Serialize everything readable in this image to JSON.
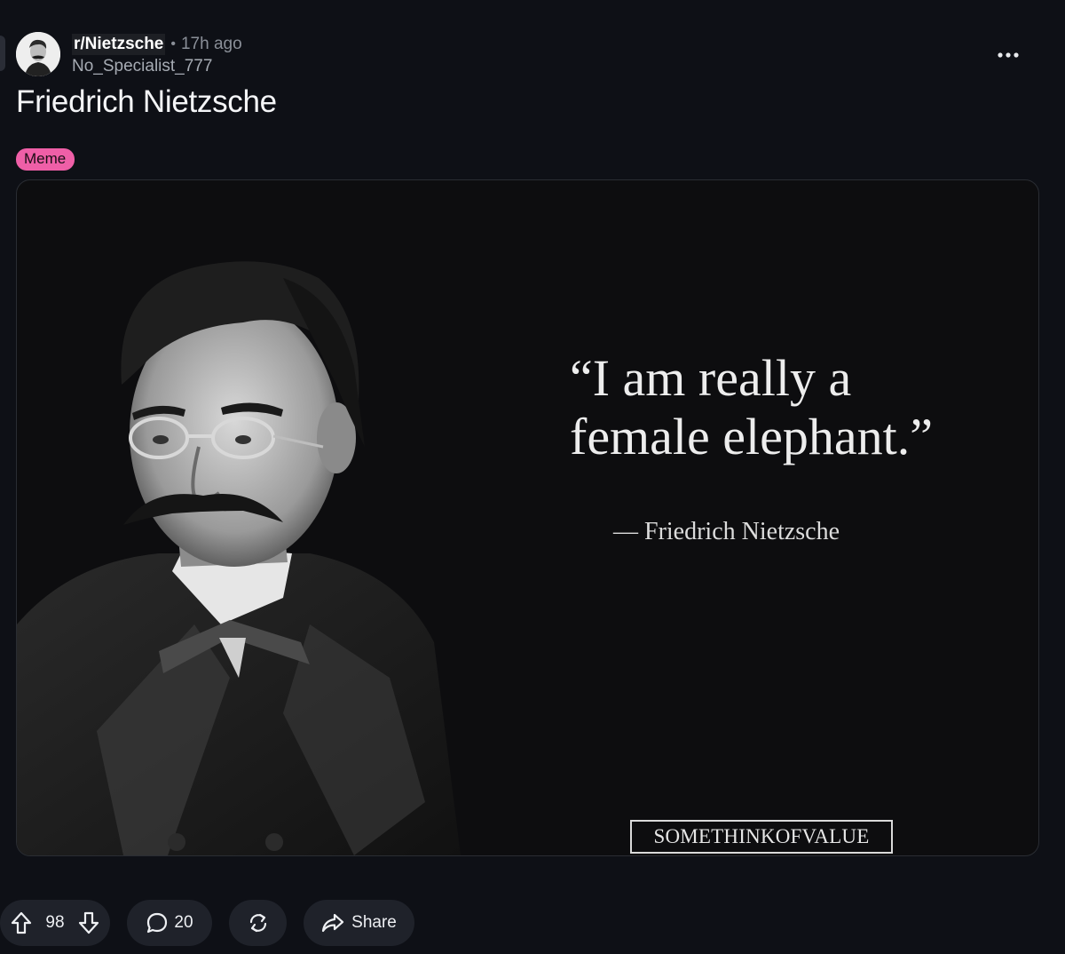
{
  "post": {
    "subreddit": "r/Nietzsche",
    "separator": "•",
    "age": "17h ago",
    "author": "No_Specialist_777",
    "title": "Friedrich Nietzsche",
    "flair": "Meme",
    "flair_color": "#ef5fa7"
  },
  "media": {
    "quote_line_1": "“I am really a",
    "quote_line_2": "female elephant.”",
    "attribution": "— Friedrich Nietzsche",
    "watermark": "SOMETHINKOFVALUE"
  },
  "actions": {
    "upvote_icon": "arrow-up-icon",
    "vote_count": "98",
    "downvote_icon": "arrow-down-icon",
    "comment_icon": "speech-bubble-icon",
    "comment_count": "20",
    "crosspost_icon": "crosspost-icon",
    "share_icon": "share-arrow-icon",
    "share_label": "Share",
    "more_icon": "ellipsis-icon"
  },
  "colors": {
    "background": "#0e1016",
    "button_bg": "#1f222a"
  }
}
